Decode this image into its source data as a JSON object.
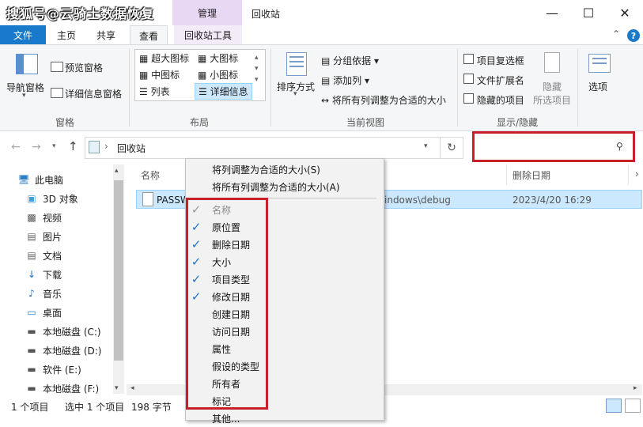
{
  "watermark": "搜狐号@云骑士数据恢复",
  "titlebar": {
    "context_tab": "管理",
    "title": "回收站"
  },
  "ribbon_tabs": [
    "文件",
    "主页",
    "共享",
    "查看",
    "回收站工具"
  ],
  "ribbon": {
    "pane": {
      "nav_pane": "导航窗格",
      "preview_pane": "预览窗格",
      "details_pane": "详细信息窗格",
      "group_label": "窗格"
    },
    "layout": {
      "items": [
        "超大图标",
        "大图标",
        "中图标",
        "小图标",
        "列表",
        "详细信息"
      ],
      "group_label": "布局"
    },
    "current_view": {
      "sort_by": "排序方式",
      "group_by": "分组依据",
      "add_columns": "添加列",
      "size_all_columns": "将所有列调整为合适的大小",
      "group_label": "当前视图"
    },
    "show_hide": {
      "item_checkboxes": "项目复选框",
      "file_extensions": "文件扩展名",
      "hidden_items": "隐藏的项目",
      "hide_selected": "隐藏",
      "hide_selected_sub": "所选项目",
      "options": "选项",
      "group_label": "显示/隐藏"
    }
  },
  "address": {
    "location": "回收站"
  },
  "nav_pane": [
    {
      "label": "此电脑",
      "icon": "computer-icon"
    },
    {
      "label": "3D 对象",
      "icon": "3d-objects-icon"
    },
    {
      "label": "视频",
      "icon": "video-icon"
    },
    {
      "label": "图片",
      "icon": "picture-icon"
    },
    {
      "label": "文档",
      "icon": "document-icon"
    },
    {
      "label": "下载",
      "icon": "download-icon"
    },
    {
      "label": "音乐",
      "icon": "music-icon"
    },
    {
      "label": "桌面",
      "icon": "desktop-icon"
    },
    {
      "label": "本地磁盘 (C:)",
      "icon": "drive-icon"
    },
    {
      "label": "本地磁盘 (D:)",
      "icon": "drive-icon"
    },
    {
      "label": "软件 (E:)",
      "icon": "drive-icon"
    },
    {
      "label": "本地磁盘 (F:)",
      "icon": "drive-icon"
    }
  ],
  "columns": {
    "name": "名称",
    "deleted_date": "删除日期"
  },
  "file_row": {
    "name_prefix": "PASSW",
    "location_suffix": "indows\\debug",
    "deleted_date": "2023/4/20 16:29"
  },
  "context_menu": {
    "size_column": "将列调整为合适的大小(S)",
    "size_all_columns": "将所有列调整为合适的大小(A)",
    "items": [
      {
        "label": "名称",
        "checked": true,
        "disabled": true
      },
      {
        "label": "原位置",
        "checked": true
      },
      {
        "label": "删除日期",
        "checked": true
      },
      {
        "label": "大小",
        "checked": true
      },
      {
        "label": "项目类型",
        "checked": true
      },
      {
        "label": "修改日期",
        "checked": true
      },
      {
        "label": "创建日期",
        "checked": false
      },
      {
        "label": "访问日期",
        "checked": false
      },
      {
        "label": "属性",
        "checked": false
      },
      {
        "label": "假设的类型",
        "checked": false
      },
      {
        "label": "所有者",
        "checked": false
      },
      {
        "label": "标记",
        "checked": false
      },
      {
        "label": "其他...",
        "checked": false
      }
    ]
  },
  "status": {
    "count": "1 个项目",
    "selected": "选中 1 个项目",
    "size": "198 字节"
  }
}
